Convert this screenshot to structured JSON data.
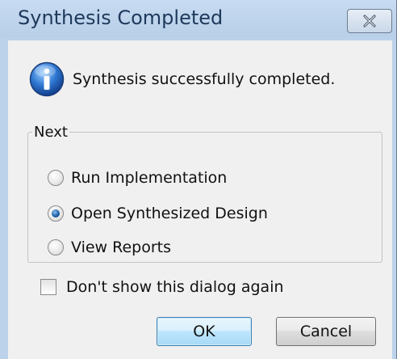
{
  "window": {
    "title": "Synthesis Completed",
    "close_icon": "close-x-icon"
  },
  "message": {
    "icon": "info-icon",
    "text": "Synthesis successfully completed."
  },
  "next_group": {
    "label": "Next",
    "options": [
      {
        "label": "Run Implementation",
        "selected": false
      },
      {
        "label": "Open Synthesized Design",
        "selected": true
      },
      {
        "label": "View Reports",
        "selected": false
      }
    ]
  },
  "dont_show": {
    "label": "Don't show this dialog again",
    "checked": false
  },
  "buttons": {
    "ok_label": "OK",
    "cancel_label": "Cancel"
  },
  "colors": {
    "titlebar": "#bcd2ea",
    "title_text": "#1e395b",
    "client_bg": "#f0f0f0",
    "radio_selected": "#1f5fa6"
  }
}
